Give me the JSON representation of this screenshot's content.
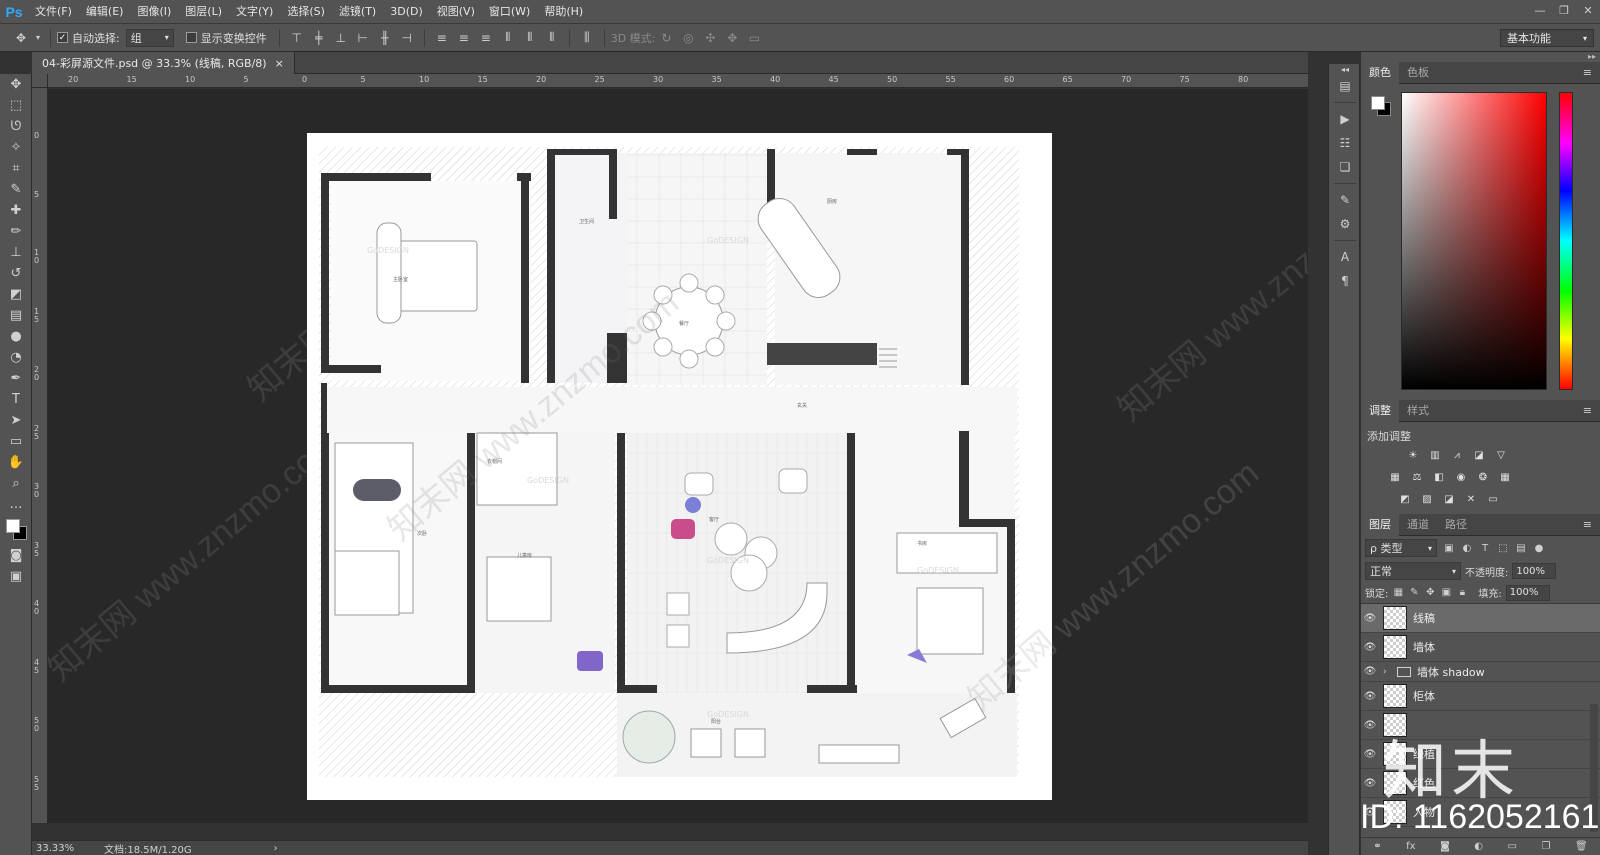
{
  "app": {
    "logo": "Ps"
  },
  "menu": [
    "文件(F)",
    "编辑(E)",
    "图像(I)",
    "图层(L)",
    "文字(Y)",
    "选择(S)",
    "滤镜(T)",
    "3D(D)",
    "视图(V)",
    "窗口(W)",
    "帮助(H)"
  ],
  "window_controls": {
    "minimize": "—",
    "restore": "❐",
    "close": "✕"
  },
  "options": {
    "auto_select_label": "自动选择:",
    "auto_select_checked": true,
    "auto_select_value": "组",
    "show_transform_label": "显示变换控件",
    "show_transform_checked": false,
    "mode_3d_label": "3D 模式:",
    "workspace": "基本功能"
  },
  "document": {
    "tab_title": "04-彩屏源文件.psd @ 33.3% (线稿, RGB/8)",
    "tab_close": "×"
  },
  "ruler_h_labels": [
    "20",
    "15",
    "10",
    "5",
    "0",
    "5",
    "10",
    "15",
    "20",
    "25",
    "30",
    "35",
    "40",
    "45",
    "50",
    "55",
    "60",
    "65",
    "70",
    "75",
    "80"
  ],
  "ruler_v_labels": [
    "0",
    "5",
    "1\n0",
    "1\n5",
    "2\n0",
    "2\n5",
    "3\n0",
    "3\n5",
    "4\n0",
    "4\n5",
    "5\n0",
    "5\n5"
  ],
  "status": {
    "zoom": "33.33%",
    "doc_size": "文档:18.5M/1.20G",
    "arrow": "›"
  },
  "color_panel": {
    "tabs": [
      "颜色",
      "色板"
    ],
    "fg": "#ffffff",
    "bg": "#000000"
  },
  "adjust_panel": {
    "tabs": [
      "调整",
      "样式"
    ],
    "add_label": "添加调整"
  },
  "layers_panel": {
    "tabs": [
      "图层",
      "通道",
      "路径"
    ],
    "filter_label": "ρ 类型",
    "blend_mode": "正常",
    "opacity_label": "不透明度:",
    "opacity_value": "100%",
    "lock_label": "锁定:",
    "fill_label": "填充:",
    "fill_value": "100%",
    "layers": [
      {
        "name": "线稿",
        "type": "layer",
        "selected": true
      },
      {
        "name": "墙体",
        "type": "layer",
        "selected": false
      },
      {
        "name": "墙体 shadow",
        "type": "group",
        "selected": false
      },
      {
        "name": "柜体",
        "type": "layer",
        "selected": false
      },
      {
        "name": "",
        "type": "layer",
        "selected": false
      },
      {
        "name": "绿植",
        "type": "layer",
        "selected": false
      },
      {
        "name": "红色",
        "type": "layer",
        "selected": false
      },
      {
        "name": "人物",
        "type": "layer",
        "selected": false
      }
    ]
  },
  "watermarks": {
    "diagonal": "知末网 www.znzmo.com",
    "big": "知末",
    "id": "ID: 1162052161"
  },
  "floorplan": {
    "rooms": [
      "主卧室",
      "衣帽间",
      "卫生间",
      "餐厅",
      "厨房",
      "客厅",
      "次卧",
      "儿童房",
      "书房",
      "阳台",
      "玄关"
    ],
    "brand": "GoDESIGN"
  }
}
